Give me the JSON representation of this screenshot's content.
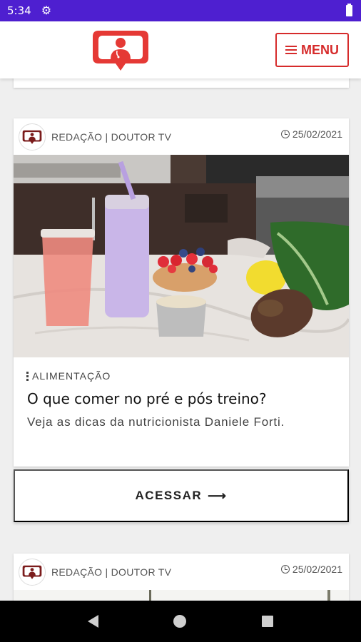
{
  "status_bar": {
    "time": "5:34"
  },
  "header": {
    "menu_label": "MENU"
  },
  "articles": [
    {
      "author": "REDAÇÃO | DOUTOR TV",
      "date": "25/02/2021",
      "category": "ALIMENTAÇÃO",
      "title": "O que comer no pré e pós treino?",
      "description": "Veja as dicas da nutricionista Daniele Forti.",
      "cta_label": "ACESSAR"
    },
    {
      "author": "REDAÇÃO | DOUTOR TV",
      "date": "25/02/2021"
    }
  ],
  "colors": {
    "brand_red": "#e53935",
    "status_bar": "#4e1fd0",
    "menu_border": "#d62b2b"
  }
}
